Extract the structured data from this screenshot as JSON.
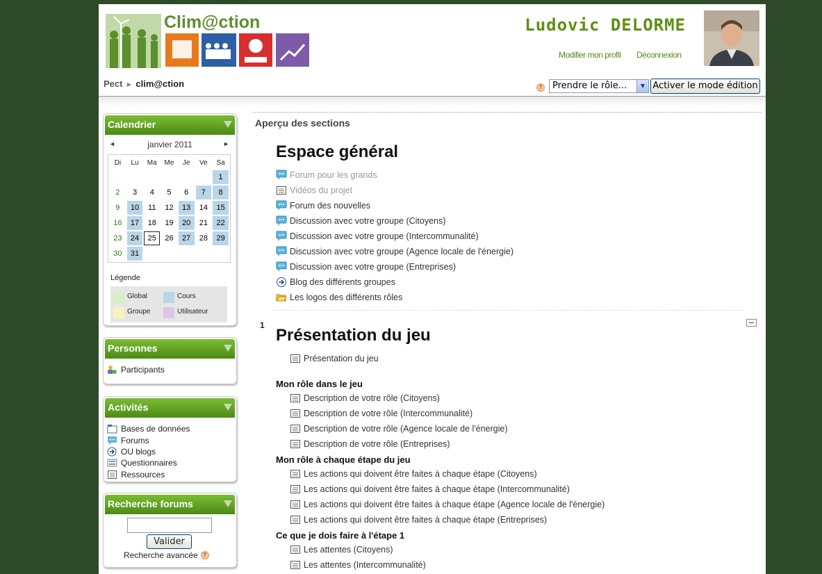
{
  "header": {
    "logo_text": "Clim@ction",
    "user_name": "Ludovic DELORME",
    "edit_profile_link": "Modifier mon profil",
    "logout_link": "Déconnexion"
  },
  "breadcrumb": {
    "root": "Pect",
    "separator": "►",
    "current": "clim@ction"
  },
  "role_select": {
    "value": "Prendre le rôle..."
  },
  "edit_button": "Activer le mode édition",
  "calendar": {
    "title": "Calendrier",
    "month": "janvier 2011",
    "day_headers": [
      "Di",
      "Lu",
      "Ma",
      "Me",
      "Je",
      "Ve",
      "Sa"
    ],
    "weeks": [
      [
        "",
        "",
        "",
        "",
        "",
        "",
        "1"
      ],
      [
        "2",
        "3",
        "4",
        "5",
        "6",
        "7",
        "8"
      ],
      [
        "9",
        "10",
        "11",
        "12",
        "13",
        "14",
        "15"
      ],
      [
        "16",
        "17",
        "18",
        "19",
        "20",
        "21",
        "22"
      ],
      [
        "23",
        "24",
        "25",
        "26",
        "27",
        "28",
        "29"
      ],
      [
        "30",
        "31",
        "",
        "",
        "",
        "",
        ""
      ]
    ],
    "event_days": [
      "1",
      "7",
      "8",
      "10",
      "13",
      "15",
      "17",
      "20",
      "22",
      "24",
      "27",
      "29",
      "31"
    ],
    "today": "25",
    "legend_title": "Légende",
    "legend": [
      "Global",
      "Cours",
      "Groupe",
      "Utilisateur"
    ]
  },
  "people_block": {
    "title": "Personnes",
    "items": [
      "Participants"
    ]
  },
  "activities_block": {
    "title": "Activités",
    "items": [
      "Bases de données",
      "Forums",
      "OU blogs",
      "Questionnaires",
      "Ressources"
    ]
  },
  "search_block": {
    "title": "Recherche forums",
    "input_value": "",
    "button": "Valider",
    "advanced_link": "Recherche avancée"
  },
  "main": {
    "title": "Aperçu des sections",
    "general_section": {
      "title": "Espace général",
      "activities": [
        {
          "label": "Forum pour les grands",
          "icon": "forum-icon",
          "dim": true
        },
        {
          "label": "Vidéos du projet",
          "icon": "page-icon",
          "dim": true
        },
        {
          "label": "Forum des nouvelles",
          "icon": "forum-icon",
          "dim": false
        },
        {
          "label": "Discussion avec votre groupe (Citoyens)",
          "icon": "forum-icon",
          "dim": false
        },
        {
          "label": "Discussion avec votre groupe (Intercommunalité)",
          "icon": "forum-icon",
          "dim": false
        },
        {
          "label": "Discussion avec votre groupe (Agence locale de l'énergie)",
          "icon": "forum-icon",
          "dim": false
        },
        {
          "label": "Discussion avec votre groupe (Entreprises)",
          "icon": "forum-icon",
          "dim": false
        },
        {
          "label": "Blog des différents groupes",
          "icon": "blog-icon",
          "dim": false
        },
        {
          "label": "Les logos des différents rôles",
          "icon": "folder-icon",
          "dim": false
        }
      ]
    },
    "section1": {
      "number": "1",
      "title": "Présentation du jeu",
      "intro": "Présentation du jeu",
      "groups": [
        {
          "label": "Mon rôle dans le jeu",
          "items": [
            "Description de votre rôle (Citoyens)",
            "Description de votre rôle (Intercommunalité)",
            "Description de votre rôle (Agence locale de l'énergie)",
            "Description de votre rôle (Entreprises)"
          ]
        },
        {
          "label": "Mon rôle à chaque étape du jeu",
          "items": [
            "Les actions qui doivent être faites à chaque étape (Citoyens)",
            "Les actions qui doivent être faites à chaque étape (Intercommunalité)",
            "Les actions qui doivent être faites à chaque étape (Agence locale de l'énergie)",
            "Les actions qui doivent être faites à chaque étape (Entreprises)"
          ]
        },
        {
          "label": "Ce que je dois faire à l'étape 1",
          "items": [
            "Les attentes (Citoyens)",
            "Les attentes (Intercommunalité)"
          ]
        }
      ]
    }
  }
}
